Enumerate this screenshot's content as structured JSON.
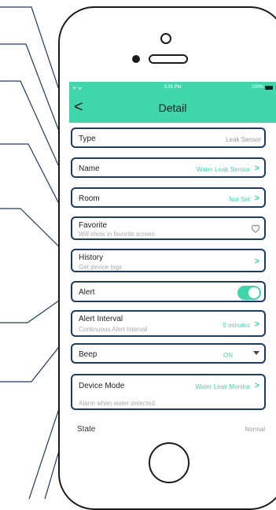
{
  "status_bar": {
    "carrier": "✈ ᯤ",
    "time": "3:26 PM",
    "battery": "100%"
  },
  "nav": {
    "back_icon": "chevron-left-icon",
    "title": "Detail"
  },
  "rows": {
    "type": {
      "label": "Type",
      "value": "Leak Sensor"
    },
    "name": {
      "label": "Name",
      "value": "Water Leak Sensor"
    },
    "room": {
      "label": "Room",
      "value": "Not Set"
    },
    "favorite": {
      "label": "Favorite",
      "subtitle": "Will show in favorite screen",
      "icon": "heart-outline-icon"
    },
    "history": {
      "label": "History",
      "subtitle": "Get device logs"
    },
    "alert": {
      "label": "Alert",
      "toggle_on": true
    },
    "alert_interval": {
      "label": "Alert Interval",
      "subtitle": "Continuous Alert Interval",
      "value": "5 minutes"
    },
    "beep": {
      "label": "Beep",
      "value": "ON"
    },
    "device_mode": {
      "label": "Device Mode",
      "value": "Water Leak Monitor",
      "subtitle": "Alarm when water detected"
    },
    "state": {
      "label": "State",
      "value": "Normal"
    }
  },
  "arrow": ">",
  "back_glyph": "<",
  "colors": {
    "accent": "#3fd6ac",
    "outline": "#1d3a68",
    "frame": "#1b1b1b"
  }
}
